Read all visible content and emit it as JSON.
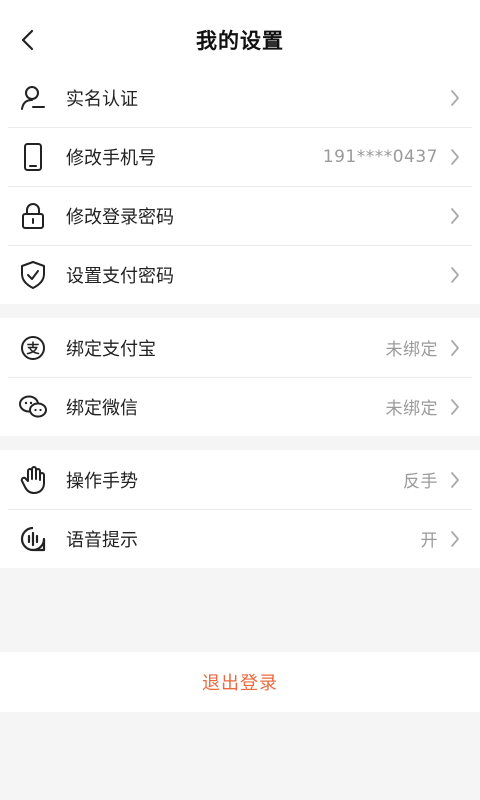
{
  "header": {
    "title": "我的设置",
    "back_icon": "back-arrow-icon"
  },
  "groups": [
    {
      "items": [
        {
          "icon": "user-verify-icon",
          "label": "实名认证",
          "value": ""
        },
        {
          "icon": "phone-icon",
          "label": "修改手机号",
          "value": "191****0437"
        },
        {
          "icon": "lock-icon",
          "label": "修改登录密码",
          "value": ""
        },
        {
          "icon": "shield-icon",
          "label": "设置支付密码",
          "value": ""
        }
      ]
    },
    {
      "items": [
        {
          "icon": "alipay-icon",
          "label": "绑定支付宝",
          "value": "未绑定"
        },
        {
          "icon": "wechat-icon",
          "label": "绑定微信",
          "value": "未绑定"
        }
      ]
    },
    {
      "items": [
        {
          "icon": "hand-gesture-icon",
          "label": "操作手势",
          "value": "反手"
        },
        {
          "icon": "voice-icon",
          "label": "语音提示",
          "value": "开"
        }
      ]
    }
  ],
  "logout": {
    "label": "退出登录",
    "color": "#ea6a3e"
  },
  "colors": {
    "background": "#f5f5f5",
    "accent": "#ea6a3e",
    "value_text": "#9a9a9a"
  }
}
